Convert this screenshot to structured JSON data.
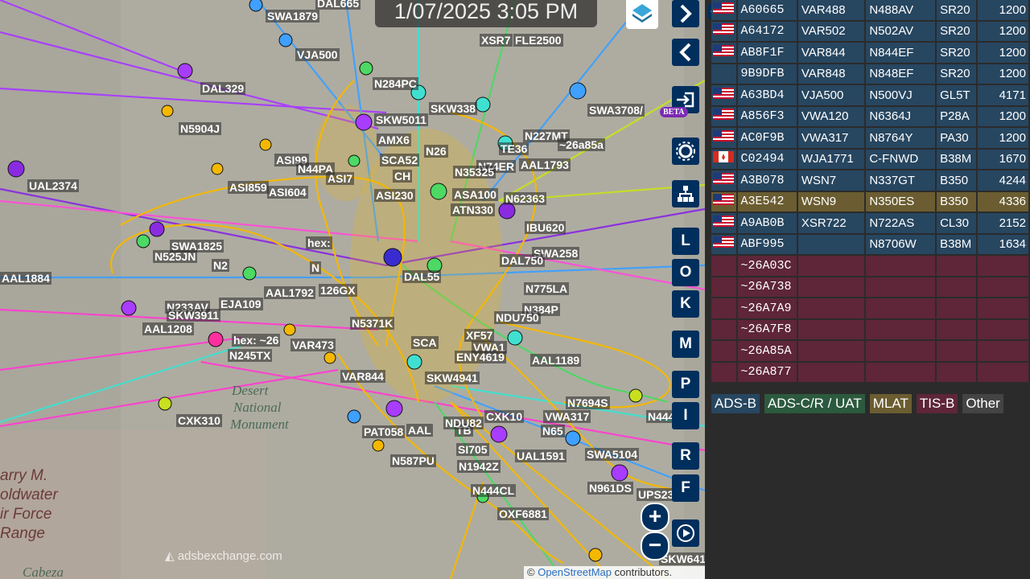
{
  "map": {
    "clock": "1/07/2025 3:05 PM",
    "attribution_prefix": "©",
    "attribution_link": "OpenStreetMap",
    "attribution_suffix": "contributors.",
    "watermark": "adsbexchange.com",
    "beta_badge": "BETA",
    "terrain_labels": [
      "Desert",
      "National",
      "Monument",
      "Cabeza"
    ],
    "range_labels": [
      "arry M.",
      "oldwater",
      "ir Force",
      "Range"
    ],
    "callsigns": [
      "SWA1879",
      "DAL665",
      "XSR7",
      "FLE2500",
      "VJA500",
      "DAL329",
      "N284PC",
      "SKW338",
      "SWA3708/",
      "N5904J",
      "SKW5011",
      "N227MT",
      "~26a85a",
      "AMX6",
      "N26",
      "TE36",
      "UAL2374",
      "ASI99",
      "N44PA",
      "SCA52",
      "N74ER",
      "AAL1793",
      "ASI859",
      "ASI604",
      "ASI7",
      "CH",
      "N35325",
      "ASI230",
      "ASA100",
      "N62363",
      "ATN330",
      "IBU620",
      "SWA1825",
      "N525JN",
      "N2",
      "hex:",
      "N",
      "SWA258",
      "AAL1884",
      "AAL1792",
      "126GX",
      "DAL55",
      "DAL750",
      "N775LA",
      "N233AV",
      "EJA109",
      "N384P",
      "SKW3911",
      "AAL1208",
      "N5371K",
      "NDU750",
      "hex: ~26",
      "N245TX",
      "VAR473",
      "XF57",
      "VWA1",
      "SCA",
      "ENY4619",
      "VAR844",
      "SKW4941",
      "AAL1189",
      "N7694S",
      "CXK310",
      "CXK10",
      "N444",
      "PAT058",
      "AAL",
      "TB",
      "NDU82",
      "VWA317",
      "N65",
      "SI705",
      "UAL1591",
      "SWA5104",
      "N587PU",
      "N1942Z",
      "N961DS",
      "UPS23",
      "N444CL",
      "OXF6881",
      "SKW641"
    ],
    "buttons_right": [
      "L",
      "O",
      "K",
      "M",
      "P",
      "I",
      "R",
      "F"
    ],
    "zoom_in": "+",
    "zoom_out": "−"
  },
  "sidebar": {
    "rows": [
      {
        "flag": "US",
        "hex": "A60665",
        "callsign": "VAR488",
        "reg": "N488AV",
        "type": "SR20",
        "alt": "1200",
        "kind": "adsb"
      },
      {
        "flag": "US",
        "hex": "A64172",
        "callsign": "VAR502",
        "reg": "N502AV",
        "type": "SR20",
        "alt": "1200",
        "kind": "adsb"
      },
      {
        "flag": "US",
        "hex": "AB8F1F",
        "callsign": "VAR844",
        "reg": "N844EF",
        "type": "SR20",
        "alt": "1200",
        "kind": "adsb"
      },
      {
        "flag": "",
        "hex": "9B9DFB",
        "callsign": "VAR848",
        "reg": "N848EF",
        "type": "SR20",
        "alt": "1200",
        "kind": "adsb"
      },
      {
        "flag": "US",
        "hex": "A63BD4",
        "callsign": "VJA500",
        "reg": "N500VJ",
        "type": "GL5T",
        "alt": "4171",
        "kind": "adsb"
      },
      {
        "flag": "US",
        "hex": "A856F3",
        "callsign": "VWA120",
        "reg": "N6364J",
        "type": "P28A",
        "alt": "1200",
        "kind": "adsb"
      },
      {
        "flag": "US",
        "hex": "AC0F9B",
        "callsign": "VWA317",
        "reg": "N8764Y",
        "type": "PA30",
        "alt": "1200",
        "kind": "adsb"
      },
      {
        "flag": "CA",
        "hex": "C02494",
        "callsign": "WJA1771",
        "reg": "C-FNWD",
        "type": "B38M",
        "alt": "1670",
        "kind": "adsb"
      },
      {
        "flag": "US",
        "hex": "A3B078",
        "callsign": "WSN7",
        "reg": "N337GT",
        "type": "B350",
        "alt": "4244",
        "kind": "adsb"
      },
      {
        "flag": "US",
        "hex": "A3E542",
        "callsign": "WSN9",
        "reg": "N350ES",
        "type": "B350",
        "alt": "4336",
        "kind": "mlat"
      },
      {
        "flag": "US",
        "hex": "A9AB0B",
        "callsign": "XSR722",
        "reg": "N722AS",
        "type": "CL30",
        "alt": "2152",
        "kind": "adsb"
      },
      {
        "flag": "US",
        "hex": "ABF995",
        "callsign": "",
        "reg": "N8706W",
        "type": "B38M",
        "alt": "1634",
        "kind": "adsb"
      },
      {
        "flag": "",
        "hex": "~26A03C",
        "callsign": "",
        "reg": "",
        "type": "",
        "alt": "",
        "kind": "tisb"
      },
      {
        "flag": "",
        "hex": "~26A738",
        "callsign": "",
        "reg": "",
        "type": "",
        "alt": "",
        "kind": "tisb"
      },
      {
        "flag": "",
        "hex": "~26A7A9",
        "callsign": "",
        "reg": "",
        "type": "",
        "alt": "",
        "kind": "tisb"
      },
      {
        "flag": "",
        "hex": "~26A7F8",
        "callsign": "",
        "reg": "",
        "type": "",
        "alt": "",
        "kind": "tisb"
      },
      {
        "flag": "",
        "hex": "~26A85A",
        "callsign": "",
        "reg": "",
        "type": "",
        "alt": "",
        "kind": "tisb"
      },
      {
        "flag": "",
        "hex": "~26A877",
        "callsign": "",
        "reg": "",
        "type": "",
        "alt": "",
        "kind": "tisb"
      }
    ],
    "legend": [
      {
        "label": "ADS-B",
        "color": "#274660"
      },
      {
        "label": "ADS-C/R / UAT",
        "color": "#2c5a3e"
      },
      {
        "label": "MLAT",
        "color": "#6b5d31"
      },
      {
        "label": "TIS-B",
        "color": "#5e2638"
      },
      {
        "label": "Other",
        "color": "#444444"
      }
    ]
  }
}
